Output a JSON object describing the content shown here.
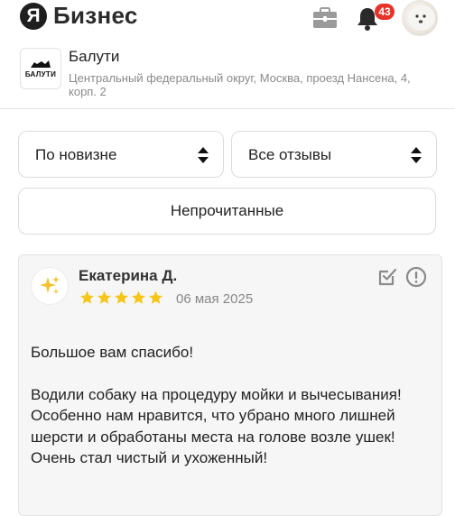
{
  "header": {
    "logo_letter": "Я",
    "logo_text": "Бизнес",
    "notifications_count": "43",
    "icons": [
      "briefcase-icon",
      "bell-icon"
    ]
  },
  "company": {
    "logo_text": "БАЛУТИ",
    "name": "Балути",
    "address": "Центральный федеральный округ, Москва, проезд Нансена, 4, корп. 2"
  },
  "filters": {
    "sort_value": "По новизне",
    "type_value": "Все отзывы",
    "unread_label": "Непрочитанные"
  },
  "review": {
    "author": "Екатерина Д.",
    "avatar_icon": "sparkles-icon",
    "rating": 5,
    "date": "06 мая 2025",
    "paragraphs": [
      "Большое вам спасибо!",
      "Водили собаку на процедуру мойки и вычесывания! Особенно нам нравится, что убрано много лишней шерсти и обработаны места на голове возле ушек! Очень стал чистый и ухоженный!"
    ]
  },
  "colors": {
    "badge": "#e5332a",
    "star": "#f5c518",
    "border": "#dcdcdc",
    "muted_text": "#8a8a8a"
  }
}
